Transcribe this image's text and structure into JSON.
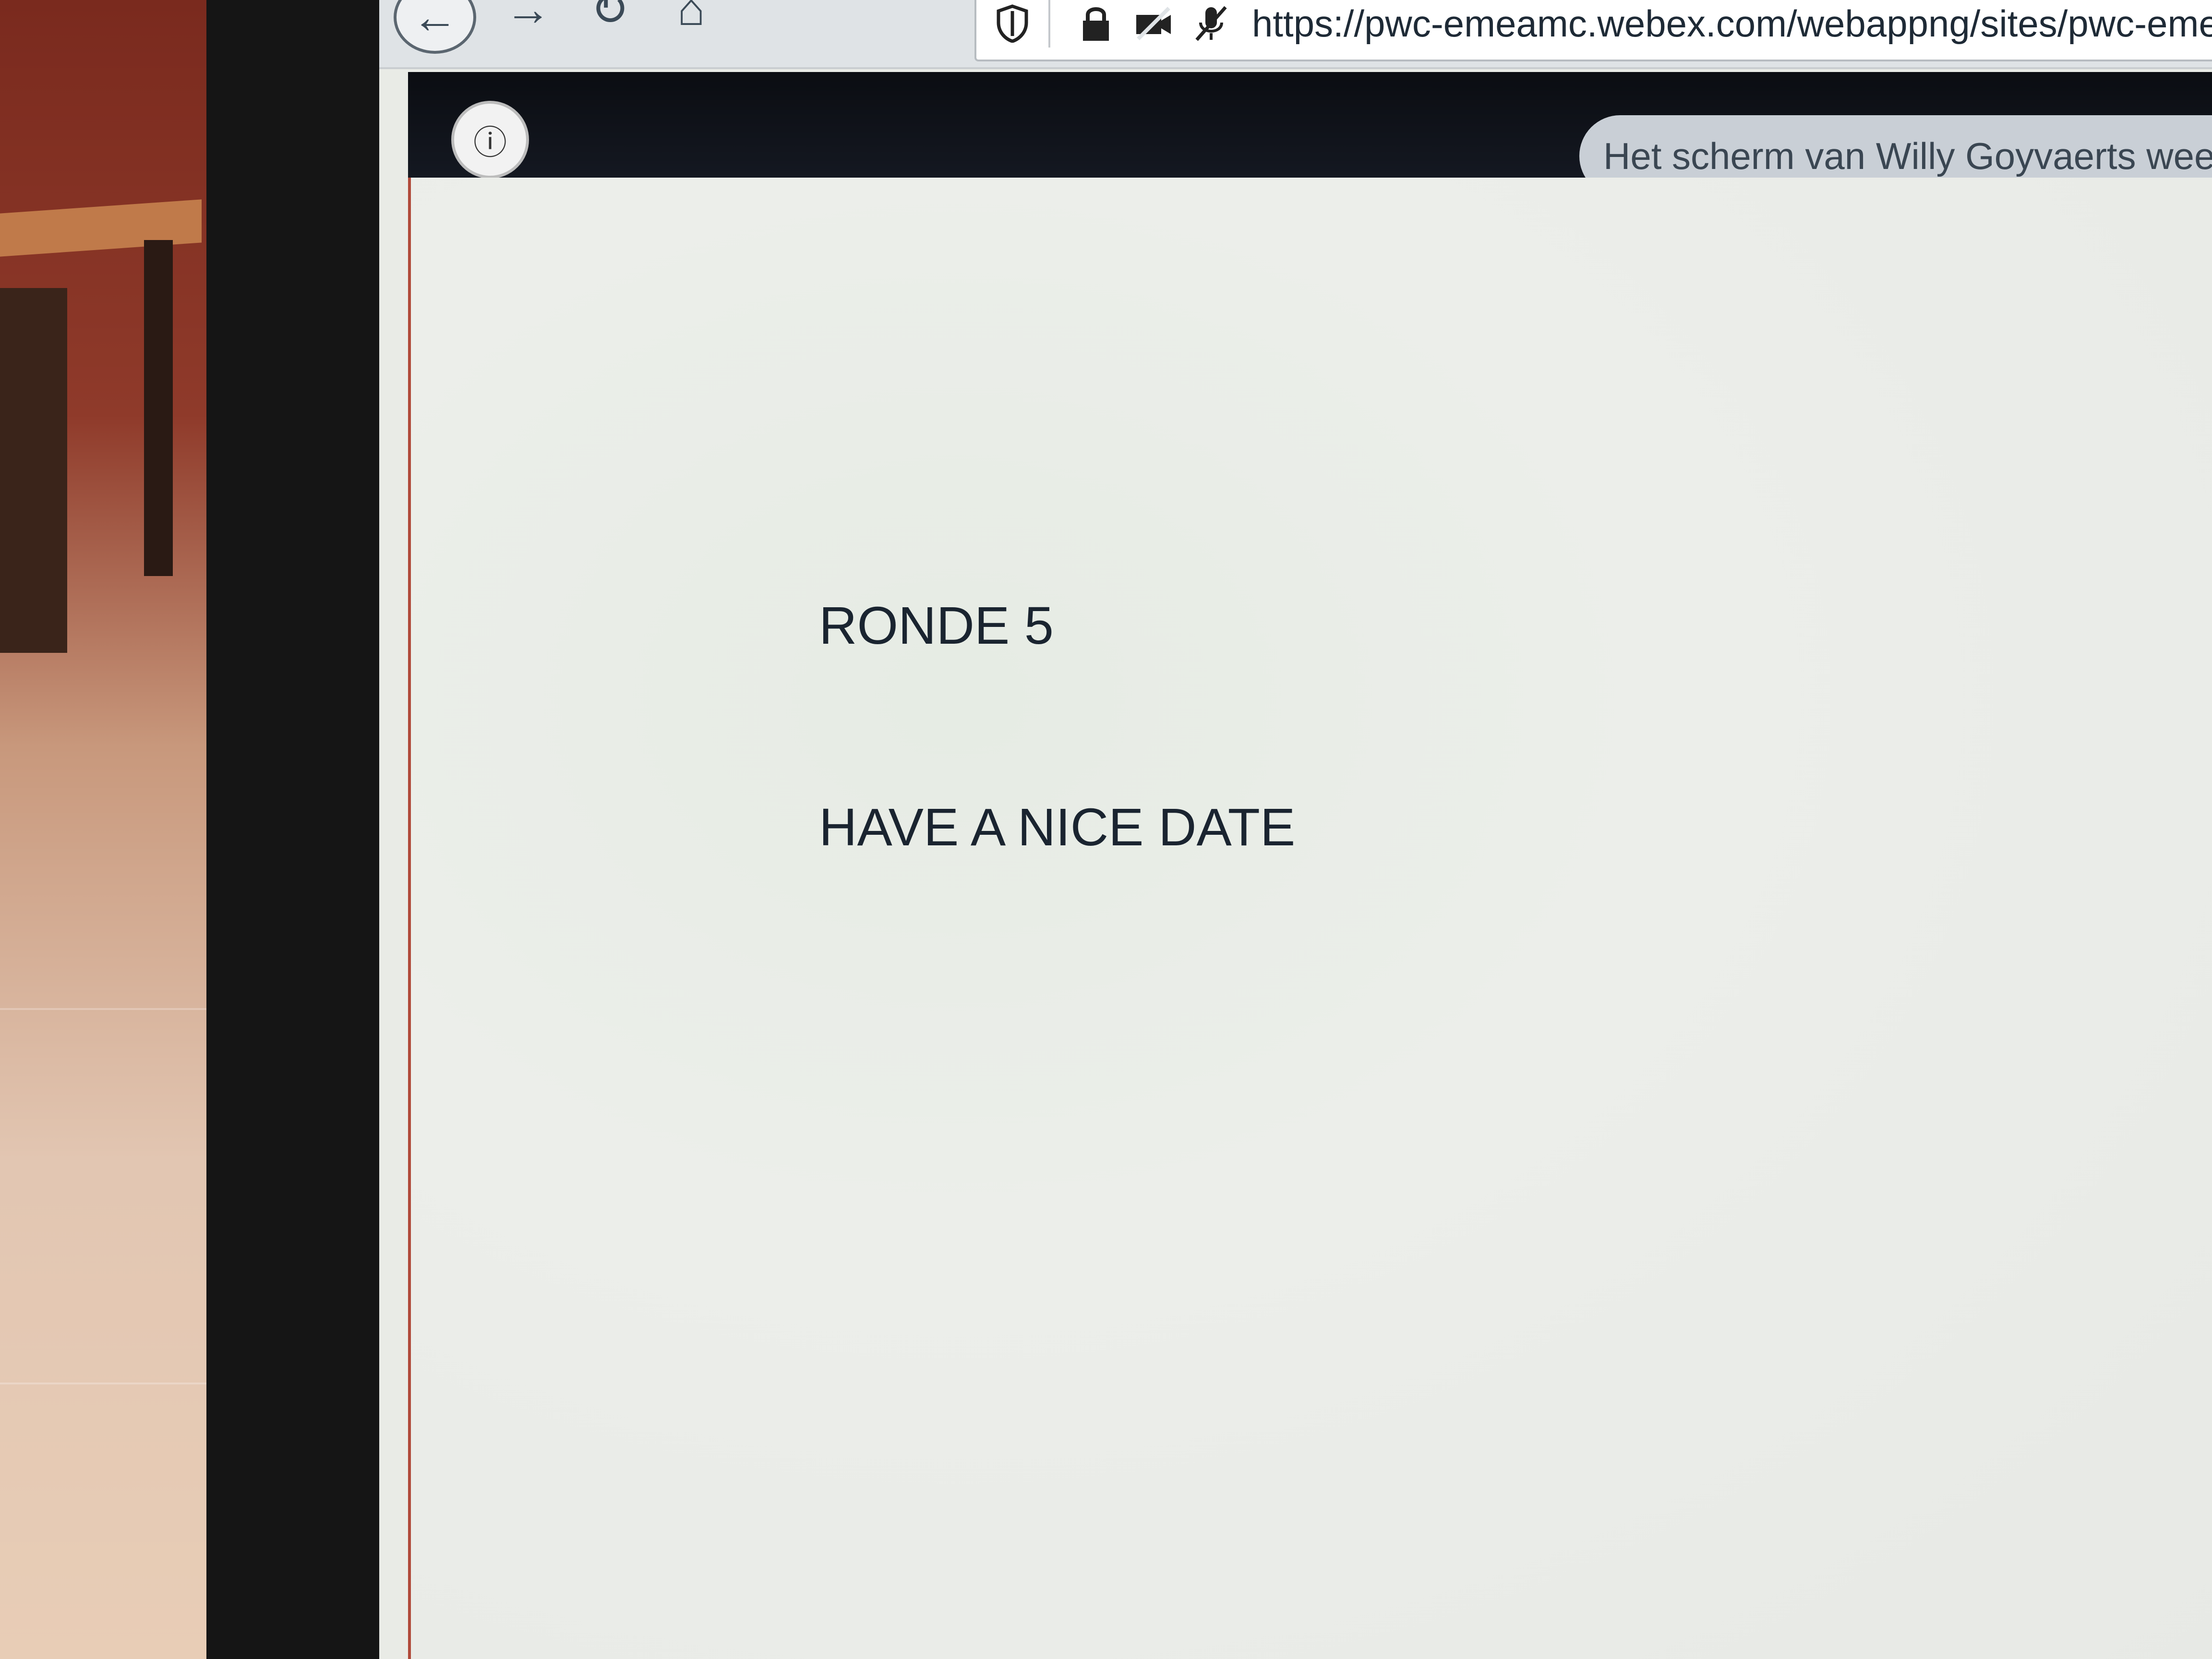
{
  "browser": {
    "back_icon": "arrow-left",
    "forward_icon": "arrow-right",
    "reload_icon": "reload",
    "home_icon": "home",
    "url": "https://pwc-emeamc.webex.com/webappng/sites/pwc-emear"
  },
  "webex": {
    "info_icon": "info",
    "share_banner": "Het scherm van Willy Goyvaerts weerg"
  },
  "slide": {
    "line1": "RONDE 5",
    "line2": "HAVE A NICE DATE"
  }
}
